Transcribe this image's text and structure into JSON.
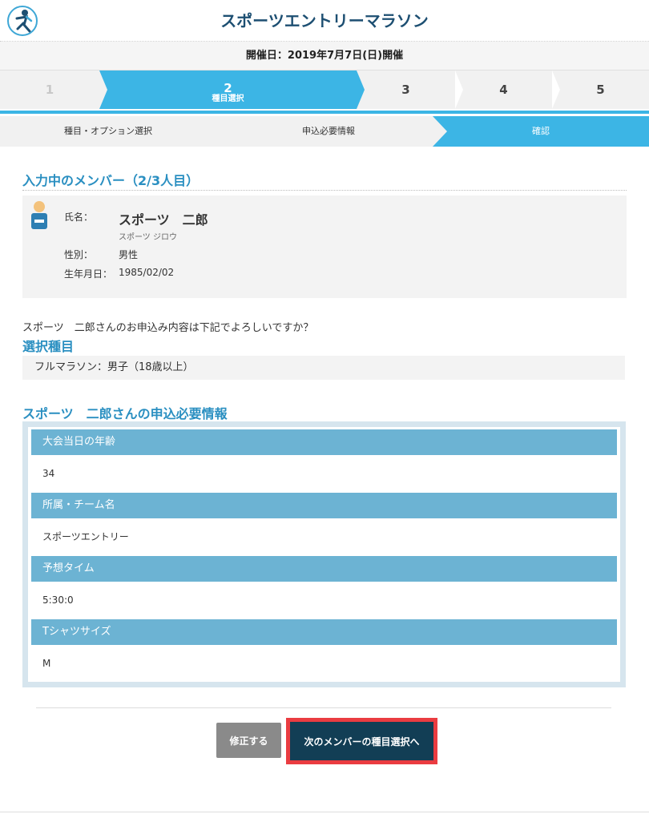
{
  "header": {
    "title": "スポーツエントリーマラソン"
  },
  "event": {
    "date_text": "開催日：2019年7月7日(日)開催"
  },
  "steps": [
    {
      "num": "1",
      "label": ""
    },
    {
      "num": "2",
      "label": "種目選択"
    },
    {
      "num": "3",
      "label": ""
    },
    {
      "num": "4",
      "label": ""
    },
    {
      "num": "5",
      "label": ""
    }
  ],
  "substeps": [
    "種目・オプション選択",
    "申込必要情報",
    "確認"
  ],
  "member_section": {
    "heading": "入力中のメンバー（2/3人目）",
    "name_label": "氏名：",
    "name": "スポーツ　二郎",
    "name_kana": "スポーツ ジロウ",
    "gender_label": "性別：",
    "gender": "男性",
    "birth_label": "生年月日：",
    "birth": "1985/02/02"
  },
  "confirm_text": "スポーツ　二郎さんのお申込み内容は下記でよろしいですか？",
  "selected_event": {
    "heading": "選択種目",
    "value": "フルマラソン：男子（18歳以上）"
  },
  "required_info": {
    "heading": "スポーツ　二郎さんの申込必要情報",
    "items": [
      {
        "label": "大会当日の年齢",
        "value": "34"
      },
      {
        "label": "所属・チーム名",
        "value": "スポーツエントリー"
      },
      {
        "label": "予想タイム",
        "value": "5:30:0"
      },
      {
        "label": "Tシャツサイズ",
        "value": "M"
      }
    ]
  },
  "buttons": {
    "edit": "修正する",
    "next": "次のメンバーの種目選択へ"
  },
  "colors": {
    "accent": "#3cb5e5",
    "heading": "#2a8fc1",
    "table_header": "#6cb3d3",
    "next_button": "#123e55",
    "highlight": "#ea3c41"
  }
}
